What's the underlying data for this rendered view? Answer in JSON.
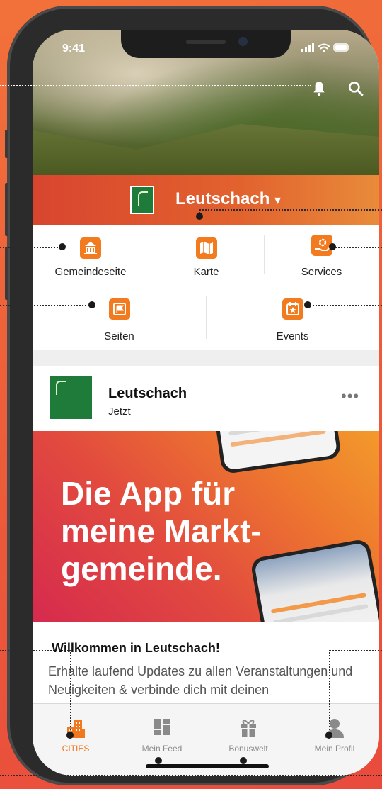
{
  "status": {
    "time": "9:41",
    "signal": "▐▐▐"
  },
  "header": {
    "notification_icon": "bell-icon",
    "search_icon": "search-icon"
  },
  "city": {
    "name": "Leutschach",
    "dropdown_glyph": "▾"
  },
  "shortcuts_row1": [
    {
      "label": "Gemeindeseite",
      "icon": "town-hall-icon"
    },
    {
      "label": "Karte",
      "icon": "map-icon"
    },
    {
      "label": "Services",
      "icon": "services-gear-hand-icon"
    }
  ],
  "shortcuts_row2": [
    {
      "label": "Seiten",
      "icon": "flag-icon"
    },
    {
      "label": "Events",
      "icon": "calendar-star-icon"
    }
  ],
  "post": {
    "author": "Leutschach",
    "time": "Jetzt",
    "more": "•••",
    "banner_text": "Die App für meine Markt-gemeinde.",
    "welcome_title": "Willkommen in Leutschach!",
    "welcome_body": "Erhalte laufend Updates zu allen Veranstaltungen und Neuigkeiten & verbinde dich mit deinen"
  },
  "tabbar": [
    {
      "label": "CITIES",
      "icon": "city-buildings-icon",
      "active": true
    },
    {
      "label": "Mein Feed",
      "icon": "feed-grid-icon",
      "active": false
    },
    {
      "label": "Bonuswelt",
      "icon": "gift-icon",
      "active": false
    },
    {
      "label": "Mein Profil",
      "icon": "profile-icon",
      "active": false
    }
  ],
  "colors": {
    "accent": "#f27a1f",
    "banner_red": "#d62a4e",
    "background": "#ec5a3a"
  }
}
